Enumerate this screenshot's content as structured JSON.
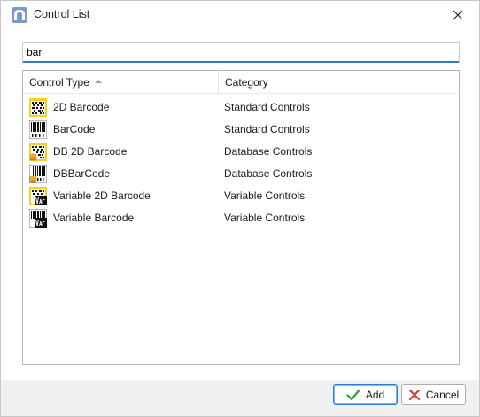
{
  "window": {
    "title": "Control List"
  },
  "search": {
    "value": "bar",
    "placeholder": ""
  },
  "list": {
    "columns": [
      "Control Type",
      "Category"
    ],
    "sort_column": "Control Type",
    "sort_direction": "ascending",
    "rows": [
      {
        "name": "2D Barcode",
        "category": "Standard Controls",
        "icon": "2d-barcode-icon"
      },
      {
        "name": "BarCode",
        "category": "Standard Controls",
        "icon": "barcode-icon"
      },
      {
        "name": "DB 2D Barcode",
        "category": "Database Controls",
        "icon": "db-2d-barcode-icon"
      },
      {
        "name": "DBBarCode",
        "category": "Database Controls",
        "icon": "db-barcode-icon"
      },
      {
        "name": "Variable 2D Barcode",
        "category": "Variable Controls",
        "icon": "variable-2d-barcode-icon"
      },
      {
        "name": "Variable Barcode",
        "category": "Variable Controls",
        "icon": "variable-barcode-icon"
      }
    ]
  },
  "buttons": {
    "add": "Add",
    "cancel": "Cancel"
  },
  "colors": {
    "accent": "#3b78b6",
    "add_check": "#2e9d3a",
    "cancel_x": "#d83b2f",
    "icon_yellow": "#f2d21c"
  }
}
